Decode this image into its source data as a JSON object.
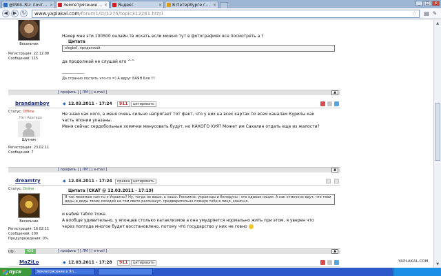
{
  "browser": {
    "tabs": [
      {
        "label": "@MAIL.RU: почта, новости...",
        "color": "#2b6cc4"
      },
      {
        "label": "Землетрясение в Японии ...",
        "color": "#c8232c"
      },
      {
        "label": "Яндекс",
        "color": "#e01b1b"
      },
      {
        "label": "В Петербурге глыба льда...",
        "color": "#d69b1c"
      }
    ],
    "url_host": "www.yaplakal.com",
    "url_path": "/forum1/st/1275/topic312261.html",
    "window_buttons": [
      "_",
      "□",
      "x"
    ]
  },
  "posts": [
    {
      "user": {
        "name": "",
        "rank": "Весельчак",
        "reg_label": "Регистрация:",
        "reg_date": "22.12.08",
        "msgs_label": "Сообщений:",
        "msgs": "115"
      },
      "lines": [
        "Нахер мне эти 100500 онлайн тв искать если можно тут в фотографиях все посмотреть а ?"
      ],
      "quote_title": "Цитата",
      "quote": "olegbel, продолжай",
      "after": "да продолжай не слушай его ^^",
      "sig_line": "------------------",
      "sig": "Да странно постить что-то =) А вдруг БАЯН Бля !!!",
      "links": "[ профиль ] [ ЛМ ] [ e-mail ]"
    },
    {
      "bar": {
        "date": "12.03.2011 - 17:24",
        "num": "911",
        "action": "цитировать"
      },
      "user": {
        "name": "brandamboy",
        "status_label": "Статус:",
        "status": "Offline",
        "avatar_text": "Нет Аватара",
        "rank": "Шутник",
        "reg_label": "Регистрация:",
        "reg_date": "23.02.11",
        "msgs_label": "Сообщений:",
        "msgs": "7"
      },
      "lines": [
        "Не знаю как кого, а меня очень сильно напрягает тот факт, что у них на всех картах по всем каналам Курилы как",
        "часть японии указаны.",
        "Меня сейчас сердобольные хомячки минусовать будут, но КАКОГО ХУЯ? Может им Сахалин отдать еще из жалости?"
      ],
      "links": "[ профиль ] [ ЛМ ] [ e-mail ]"
    },
    {
      "bar": {
        "date": "12.03.2011 - 17:24",
        "edit": "правка",
        "action": "цитировать"
      },
      "user": {
        "name": "dreamtry",
        "status_label": "Статус:",
        "status": "Online",
        "rank": "Весельчак",
        "reg_label": "Регистрация:",
        "reg_date": "16.02.11",
        "msgs_label": "Сообщений:",
        "msgs": "100",
        "warn_label": "Предупреждения:",
        "warn": "0%",
        "uq_label": "UQ:",
        "uq": "456"
      },
      "quote_title": "Цитата (CKAT @ 12.03.2011 - 17:19)",
      "quote": "Я так понимаю сам ты с Украины? Ну, тогда не ваши, а наши. Россияне, украинцы и белорусы - это единая нация. А как отмечено вдут, что твои деды и деды твоих соседей на том свете расскажут, предварительно плюнув тебе в лицо, конечно.",
      "after": "и набив табло тоже.",
      "lines": [
        "А вообще удивительно, у японцев столько катаклизмов а она умудряется нормально жить при этом, я уверен что",
        "через полгода многое будет восстановлено, потому что государство у них не говно"
      ],
      "links": "[ профиль ] [ ЛМ ] [ e-mail ]"
    },
    {
      "bar": {
        "date": "12.03.2011 - 17:28",
        "num": "911",
        "action": "цитировать"
      },
      "user": {
        "name": "MaZiLo"
      }
    }
  ],
  "taskbar": {
    "start": "пуск",
    "items": [
      "Землетрясение в Яп...",
      ""
    ]
  },
  "watermark": "YAPLAKAL.COM"
}
